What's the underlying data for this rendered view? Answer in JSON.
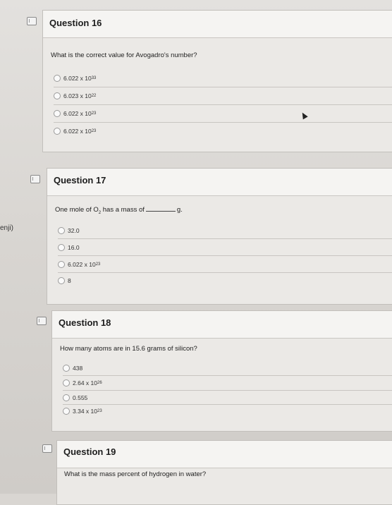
{
  "side_label": "enji)",
  "questions": [
    {
      "title": "Question 16",
      "text": "What is the correct value for Avogadro's number?",
      "options": [
        {
          "base": "6.022 x 10",
          "exp": "33"
        },
        {
          "base": "6.023 x 10",
          "exp": "22"
        },
        {
          "base": "6.022 x 10",
          "exp": "23"
        },
        {
          "base": "6.022 x 10",
          "exp": "23"
        }
      ]
    },
    {
      "title": "Question 17",
      "text_before": "One mole of O",
      "text_sub": "2",
      "text_after": " has a mass of",
      "text_unit": "g.",
      "options": [
        {
          "base": "32.0",
          "exp": ""
        },
        {
          "base": "16.0",
          "exp": ""
        },
        {
          "base": "6.022 x 10",
          "exp": "23"
        },
        {
          "base": "8",
          "exp": ""
        }
      ]
    },
    {
      "title": "Question 18",
      "text": "How many atoms are in 15.6 grams of silicon?",
      "options": [
        {
          "base": "438",
          "exp": ""
        },
        {
          "base": "2.64 x 10",
          "exp": "26"
        },
        {
          "base": "0.555",
          "exp": ""
        },
        {
          "base": "3.34 x 10",
          "exp": "23"
        }
      ]
    },
    {
      "title": "Question 19",
      "text": "What is the mass percent of hydrogen in water?"
    }
  ]
}
